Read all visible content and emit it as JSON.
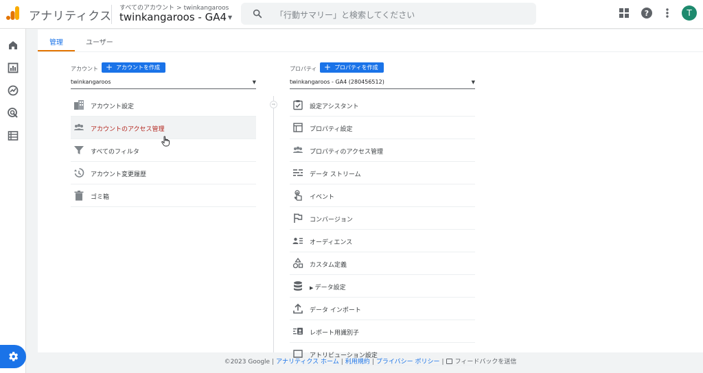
{
  "header": {
    "app_title": "アナリティクス",
    "breadcrumb_root": "すべてのアカウント",
    "breadcrumb_separator": ">",
    "breadcrumb_account": "twinkangaroos",
    "property_name": "twinkangaroos - GA4",
    "search_placeholder": "「行動サマリー」と検索してください",
    "avatar_letter": "T",
    "icons": [
      "analytics-logo",
      "search-icon",
      "apps-grid-icon",
      "help-icon",
      "more-vert-icon"
    ]
  },
  "rail": {
    "icons": [
      "home-icon",
      "reports-icon",
      "explore-icon",
      "advertising-icon",
      "configure-icon",
      "admin-gear-icon"
    ]
  },
  "tabs": [
    {
      "label": "管理",
      "active": true
    },
    {
      "label": "ユーザー",
      "active": false
    }
  ],
  "account_column": {
    "label": "アカウント",
    "create_button": "アカウントを作成",
    "selected": "twinkangaroos",
    "items": [
      {
        "label": "アカウント設定",
        "icon": "building-icon"
      },
      {
        "label": "アカウントのアクセス管理",
        "icon": "people-icon",
        "highlighted": true
      },
      {
        "label": "すべてのフィルタ",
        "icon": "filter-icon"
      },
      {
        "label": "アカウント変更履歴",
        "icon": "history-icon"
      },
      {
        "label": "ゴミ箱",
        "icon": "trash-icon"
      }
    ]
  },
  "property_column": {
    "label": "プロパティ",
    "create_button": "プロパティを作成",
    "selected": "twinkangaroos - GA4 (280456512)",
    "items": [
      {
        "label": "設定アシスタント",
        "icon": "checklist-icon"
      },
      {
        "label": "プロパティ設定",
        "icon": "property-settings-icon"
      },
      {
        "label": "プロパティのアクセス管理",
        "icon": "people-icon"
      },
      {
        "label": "データ ストリーム",
        "icon": "data-stream-icon"
      },
      {
        "label": "イベント",
        "icon": "touch-icon"
      },
      {
        "label": "コンバージョン",
        "icon": "flag-icon"
      },
      {
        "label": "オーディエンス",
        "icon": "audience-icon"
      },
      {
        "label": "カスタム定義",
        "icon": "shapes-icon"
      },
      {
        "label": "データ設定",
        "icon": "database-icon",
        "expandable": true
      },
      {
        "label": "データ インポート",
        "icon": "upload-icon"
      },
      {
        "label": "レポート用識別子",
        "icon": "identity-icon"
      },
      {
        "label": "アトリビューション設定",
        "icon": "attribution-icon"
      }
    ]
  },
  "footer": {
    "copyright": "©2023 Google",
    "links": [
      "アナリティクス ホーム",
      "利用規約",
      "プライバシー ポリシー"
    ],
    "feedback": "フィードバックを送信"
  },
  "colors": {
    "accent_blue": "#1a73e8",
    "tab_underline_orange": "#e37400",
    "highlight_text": "#b3261e",
    "avatar_green": "#1e8a6e"
  }
}
